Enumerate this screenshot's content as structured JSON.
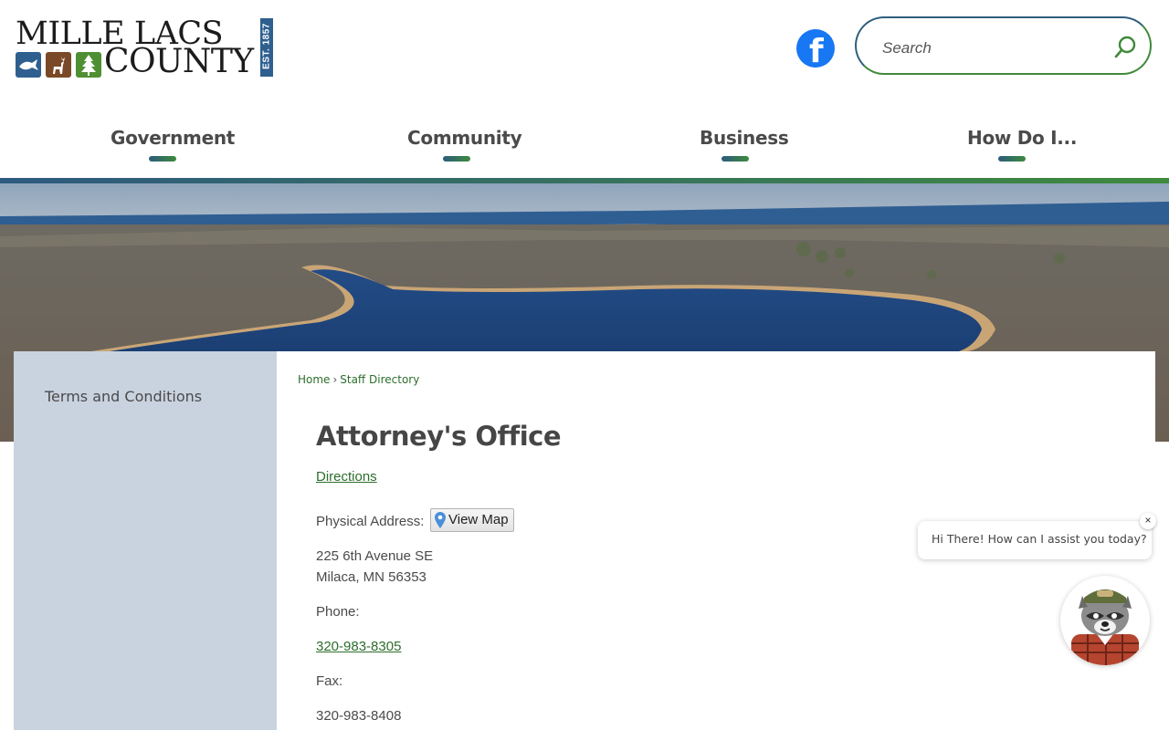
{
  "header": {
    "logo": {
      "line1": "MILLE LACS",
      "line2": "COUNTY",
      "est": "EST. 1857",
      "icons": [
        "fish-icon",
        "deer-icon",
        "pine-tree-icon"
      ]
    },
    "social": {
      "icon": "facebook-icon",
      "color": "#1877f2"
    },
    "search": {
      "placeholder": "Search",
      "icon": "search-icon"
    }
  },
  "nav": {
    "items": [
      {
        "label": "Government"
      },
      {
        "label": "Community"
      },
      {
        "label": "Business"
      },
      {
        "label": "How Do I..."
      }
    ]
  },
  "sidebar": {
    "items": [
      {
        "label": "Terms and Conditions"
      }
    ]
  },
  "breadcrumb": {
    "items": [
      {
        "label": "Home"
      },
      {
        "label": "Staff Directory"
      }
    ],
    "separator": "›"
  },
  "main": {
    "title": "Attorney's Office",
    "directions_label": "Directions",
    "physical_address_label": "Physical Address:",
    "view_map_label": "View Map",
    "address_line1": "225 6th Avenue SE",
    "address_line2": "Milaca, MN 56353",
    "phone_label": "Phone:",
    "phone": "320-983-8305",
    "fax_label": "Fax:",
    "fax": "320-983-8408"
  },
  "chat": {
    "message": "Hi There! How can I assist you today?",
    "close_label": "×",
    "avatar": "raccoon-mascot"
  },
  "colors": {
    "brand_blue": "#2e5a80",
    "brand_green": "#3e8a3e",
    "link_green": "#2c6e2c",
    "sidebar_bg": "#c9d3e0"
  }
}
